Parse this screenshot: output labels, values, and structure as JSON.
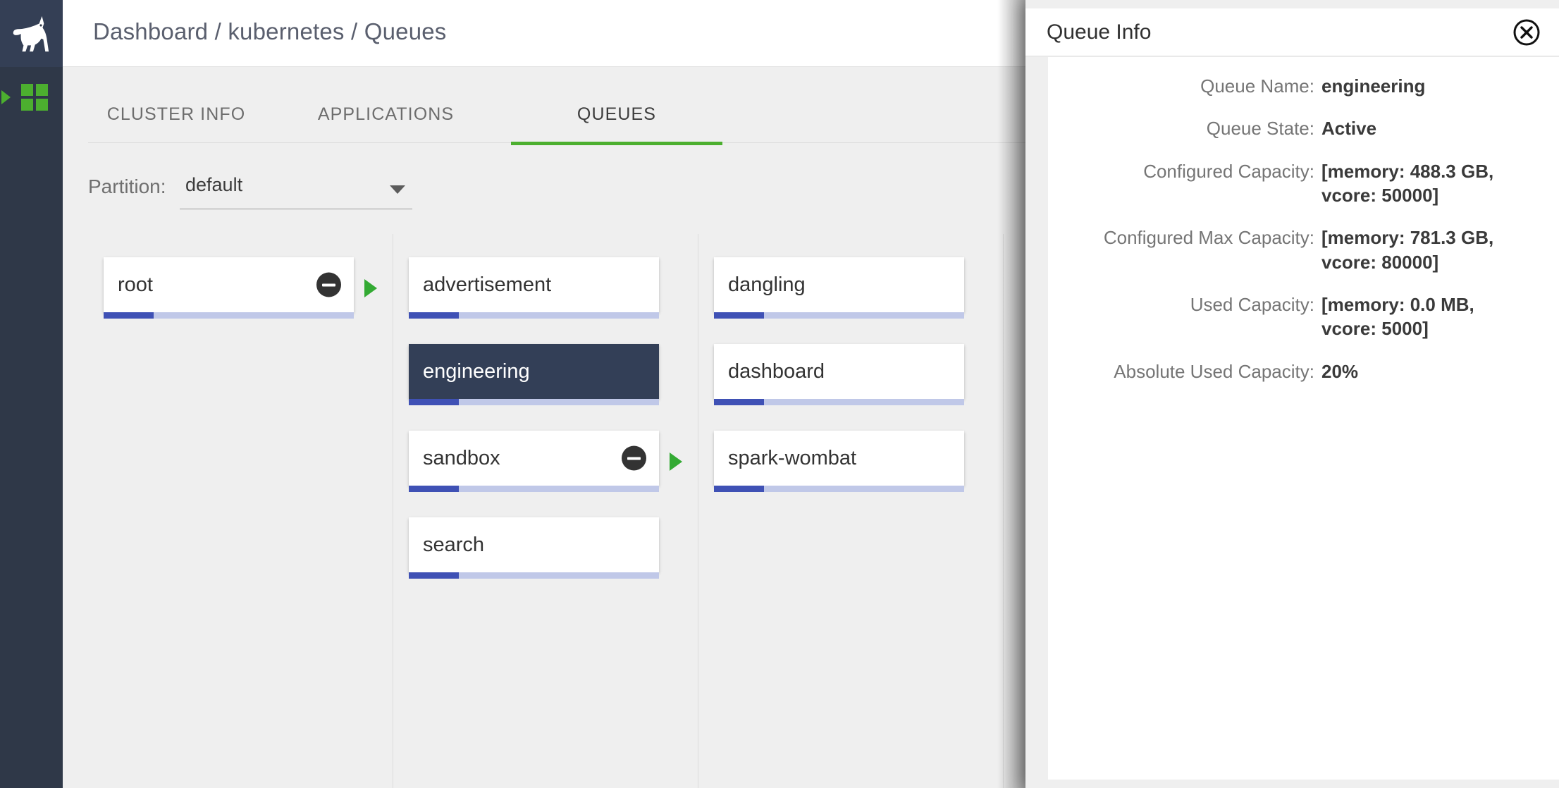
{
  "app": {
    "logo_icon": "unicorn-logo",
    "breadcrumb": "Dashboard / kubernetes / Queues"
  },
  "sidebar": {
    "items": [
      {
        "id": "dashboard",
        "icon": "grid-squares-icon",
        "active": true,
        "accent": "#4caf2f"
      }
    ]
  },
  "tabs": [
    {
      "label": "CLUSTER INFO",
      "active": false
    },
    {
      "label": "APPLICATIONS",
      "active": false
    },
    {
      "label": "QUEUES",
      "active": true
    }
  ],
  "partition": {
    "label": "Partition:",
    "value": "default",
    "caret_icon": "chevron-down-icon"
  },
  "queue_columns": [
    {
      "cards": [
        {
          "name": "root",
          "progress": 20,
          "collapsible": true,
          "expandable": true,
          "selected": false
        }
      ]
    },
    {
      "cards": [
        {
          "name": "advertisement",
          "progress": 20,
          "collapsible": false,
          "expandable": false,
          "selected": false
        },
        {
          "name": "engineering",
          "progress": 20,
          "collapsible": false,
          "expandable": false,
          "selected": true
        },
        {
          "name": "sandbox",
          "progress": 20,
          "collapsible": true,
          "expandable": true,
          "selected": false
        },
        {
          "name": "search",
          "progress": 20,
          "collapsible": false,
          "expandable": false,
          "selected": false
        }
      ]
    },
    {
      "cards": [
        {
          "name": "dangling",
          "progress": 20,
          "collapsible": false,
          "expandable": false,
          "selected": false
        },
        {
          "name": "dashboard",
          "progress": 20,
          "collapsible": false,
          "expandable": false,
          "selected": false
        },
        {
          "name": "spark-wombat",
          "progress": 20,
          "collapsible": false,
          "expandable": false,
          "selected": false
        }
      ]
    },
    {
      "cards": []
    }
  ],
  "queue_info": {
    "title": "Queue Info",
    "close_icon": "close-circle-icon",
    "rows": [
      {
        "label": "Queue Name:",
        "value": "engineering"
      },
      {
        "label": "Queue State:",
        "value": "Active"
      },
      {
        "label": "Configured Capacity:",
        "value": "[memory: 488.3 GB, vcore: 50000]"
      },
      {
        "label": "Configured Max Capacity:",
        "value": "[memory: 781.3 GB, vcore: 80000]"
      },
      {
        "label": "Used Capacity:",
        "value": "[memory: 0.0 MB, vcore: 5000]"
      },
      {
        "label": "Absolute Used Capacity:",
        "value": "20%"
      }
    ]
  },
  "colors": {
    "rail": "#2f3848",
    "accent_green": "#4caf2f",
    "selected_card": "#333f57",
    "progress_fill": "#3f51b5",
    "progress_track": "#c0c8e8",
    "content_bg": "#efefef"
  }
}
